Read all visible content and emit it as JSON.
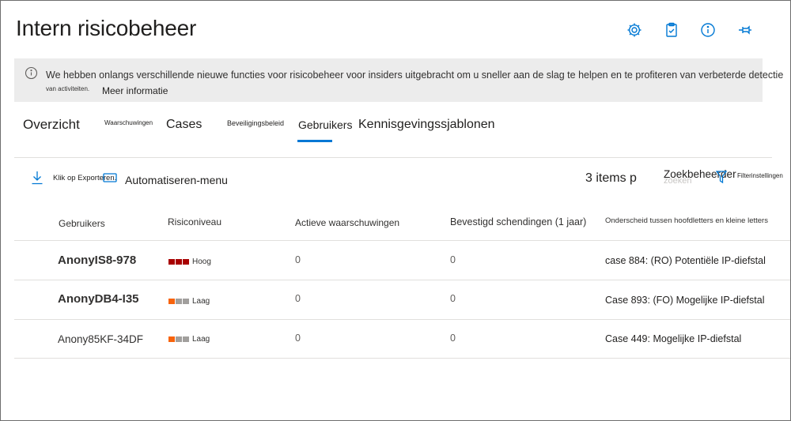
{
  "app": {
    "title": "Intern risicobeheer"
  },
  "header_icons": [
    "gear-icon",
    "clipboard-icon",
    "info-icon",
    "pin-icon"
  ],
  "banner": {
    "text": "We hebben onlangs verschillende nieuwe functies voor risicobeheer voor insiders uitgebracht om u sneller aan de slag te helpen en te profiteren van verbeterde detectie",
    "text2": "van activiteiten.",
    "link": "Meer informatie"
  },
  "tabs": [
    {
      "label": "Overzicht",
      "active": false
    },
    {
      "label": "Waarschuwingen",
      "active": false
    },
    {
      "label": "Cases",
      "active": false
    },
    {
      "label": "Beveiligingsbeleid",
      "active": false
    },
    {
      "label": "Gebruikers",
      "active": true
    },
    {
      "label": "Kennisgevingssjablonen",
      "active": false
    }
  ],
  "commands": {
    "export": "Klik op Exporteren.",
    "automate": "Automatiseren-menu",
    "count": "3 items p",
    "search": "Zoekbeheerder",
    "search_ghost": "zoeken",
    "filter": "Filterinstellingen"
  },
  "table": {
    "headers": [
      "Gebruikers",
      "Risiconiveau",
      "Actieve waarschuwingen",
      "Bevestigd schendingen (1 jaar)",
      "Onderscheid tussen hoofdletters en kleine letters"
    ],
    "rows": [
      {
        "user": "AnonyIS8-978",
        "risk": "Hoog",
        "alerts": "0",
        "violations": "0",
        "case": "case 884: (RO) Potentiële IP-diefstal"
      },
      {
        "user": "AnonyDB4-I35",
        "risk": "Laag",
        "alerts": "0",
        "violations": "0",
        "case": "Case 893: (FO) Mogelijke IP-diefstal"
      },
      {
        "user": "Anony85KF-34DF",
        "risk": "Laag",
        "alerts": "0",
        "violations": "0",
        "case": "Case 449: Mogelijke IP-diefstal"
      }
    ]
  },
  "colors": {
    "accent": "#0078d4",
    "high": "#a80000",
    "low": "#f7630c",
    "inactive": "#a19f9d"
  }
}
